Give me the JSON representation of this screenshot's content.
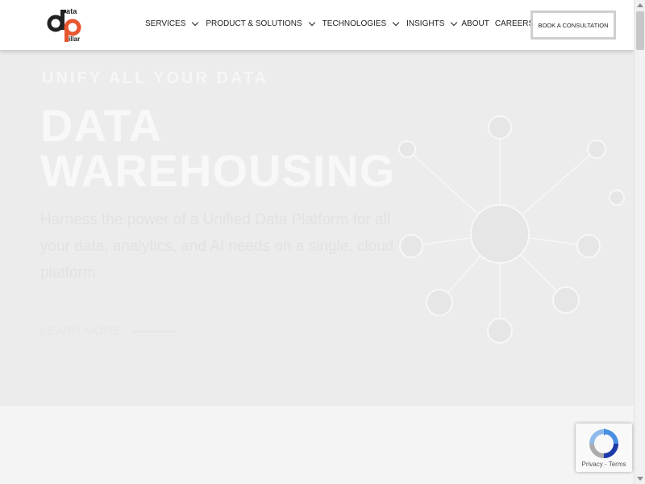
{
  "logo": {
    "text_top": "ata",
    "text_bottom": "illar",
    "colors": {
      "primary": "#222222",
      "accent": "#e8562f"
    }
  },
  "nav": {
    "items": [
      {
        "label": "SERVICES",
        "has_dropdown": true
      },
      {
        "label": "PRODUCT & SOLUTIONS",
        "has_dropdown": true
      },
      {
        "label": "TECHNOLOGIES",
        "has_dropdown": true
      },
      {
        "label": "INSIGHTS",
        "has_dropdown": true
      },
      {
        "label": "ABOUT",
        "has_dropdown": false
      },
      {
        "label": "CAREERS",
        "has_dropdown": false
      }
    ],
    "cta_label": "BOOK A CONSULTATION",
    "dropdown_icon": "chevron-down-icon"
  },
  "hero": {
    "eyebrow": "UNIFY ALL YOUR DATA",
    "title_line1": "DATA",
    "title_line2": "WAREHOUSING",
    "description": "Harness the power of a Unified Data Platform for all your data, analytics, and AI needs on a single, cloud platform",
    "link_label": "LEARN MORE"
  },
  "recaptcha": {
    "privacy": "Privacy",
    "separator": "-",
    "terms": "Terms"
  },
  "colors": {
    "background": "#f2f2f2",
    "header_bg": "#ffffff",
    "accent": "#e8562f",
    "recaptcha_blue": "#4a90e2"
  }
}
